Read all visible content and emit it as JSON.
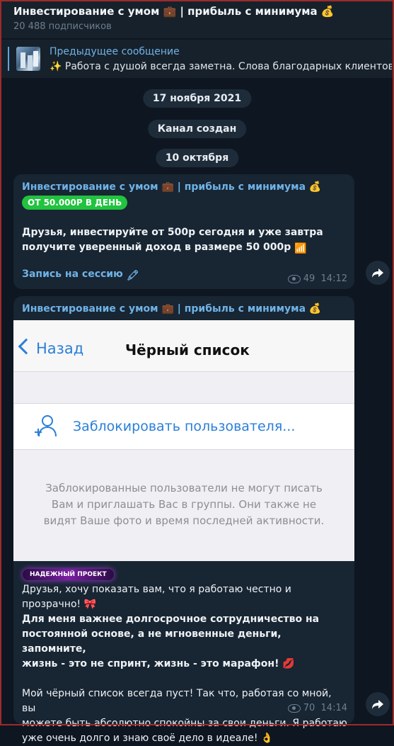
{
  "header": {
    "title": "Инвестирование с умом 💼 | прибыль с минимума 💰",
    "subscribers": "20 488 подписчиков"
  },
  "pinned": {
    "label": "Предыдущее сообщение",
    "text": "✨ Работа с душой всегда заметна. Слова благодарных клиентов,"
  },
  "dates": [
    "17 ноября 2021",
    "Канал создан",
    "10 октября"
  ],
  "post1": {
    "sender": "Инвестирование с умом 💼 | прибыль с минимума 💰",
    "badge": "ОТ 50.000Р В ДЕНЬ",
    "text_line1": "Друзья, инвестируйте от 500р сегодня и уже завтра",
    "text_line2": "получите уверенный доход в размере 50 000р",
    "text_emoji": "📶",
    "link": "Запись на сессию",
    "link_emoji": "🖍",
    "views": "49",
    "time": "14:12"
  },
  "post2": {
    "sender": "Инвестирование с умом 💼 | прибыль с минимума 💰",
    "screenshot": {
      "back": "Назад",
      "title": "Чёрный список",
      "row_label": "Заблокировать пользователя...",
      "note_line1": "Заблокированные пользователи не могут писать",
      "note_line2": "Вам и приглашать Вас в группы. Они также не",
      "note_line3": "видят Ваше фото и время последней активности."
    },
    "tag": "НАДЕЖНЫЙ ПРОЕКТ",
    "para1_line1": "Друзья, хочу показать вам, что я работаю честно и",
    "para1_line2": "прозрачно! 🎀",
    "para2_line1": "Для меня важнее долгосрочное сотрудничество на",
    "para2_line2": "постоянной основе, а не мгновенные деньги, запомните,",
    "para2_line3": "жизнь - это не спринт, жизнь - это марафон! 💋",
    "para3_line1": "Мой чёрный список всегда пуст! Так что, работая со мной, вы",
    "para3_line2": "можете быть абсолютно спокойны за свои деньги. Я работаю",
    "para3_line3": "уже очень долго и знаю своё дело в идеале! 👌",
    "views": "70",
    "time": "14:14"
  },
  "colors": {
    "background": "#0e1621",
    "bubble": "#182533",
    "link": "#6fb3e6",
    "badge_green": "#21c33f",
    "ios_blue": "#2a7fd8"
  },
  "icons": {
    "views": "eye-icon",
    "share": "share-arrow-icon",
    "add_user": "add-user-icon",
    "back": "chevron-left-icon"
  }
}
